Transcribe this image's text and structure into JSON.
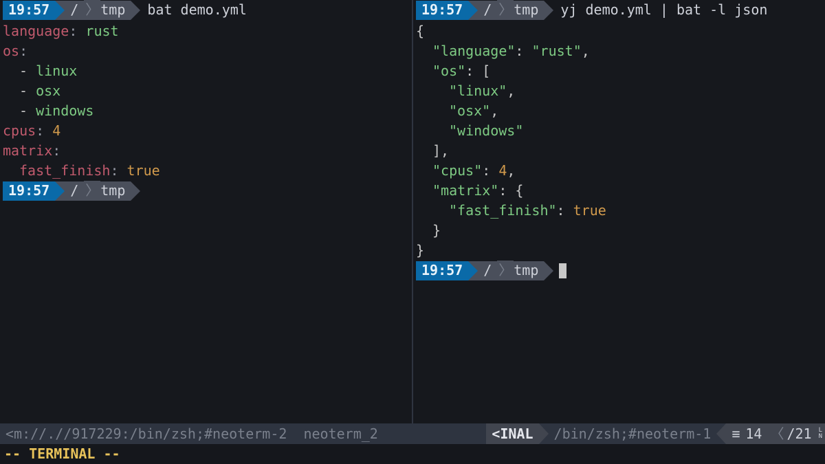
{
  "left": {
    "prompt1": {
      "time": "19:57",
      "root": "/",
      "dir": "tmp",
      "cmd": "bat demo.yml"
    },
    "yaml": {
      "language_key": "language",
      "language_val": "rust",
      "os_key": "os",
      "os_items": [
        "linux",
        "osx",
        "windows"
      ],
      "cpus_key": "cpus",
      "cpus_val": "4",
      "matrix_key": "matrix",
      "ff_key": "fast_finish",
      "ff_val": "true"
    },
    "prompt2": {
      "time": "19:57",
      "root": "/",
      "dir": "tmp"
    }
  },
  "right": {
    "prompt1": {
      "time": "19:57",
      "root": "/",
      "dir": "tmp",
      "cmd": "yj demo.yml | bat -l json"
    },
    "json": {
      "brace_open": "{",
      "language_key": "\"language\"",
      "language_val": "\"rust\"",
      "os_key": "\"os\"",
      "bracket_open": "[",
      "os_items": [
        "\"linux\"",
        "\"osx\"",
        "\"windows\""
      ],
      "bracket_close": "]",
      "cpus_key": "\"cpus\"",
      "cpus_val": "4",
      "matrix_key": "\"matrix\"",
      "brace_open2": "{",
      "ff_key": "\"fast_finish\"",
      "ff_val": "true",
      "brace_close2": "}",
      "brace_close": "}"
    },
    "prompt2": {
      "time": "19:57",
      "root": "/",
      "dir": "tmp"
    }
  },
  "statusbar": {
    "left_text": "<m://.//917229:/bin/zsh;#neoterm-2  neoterm_2",
    "right_mode": "<INAL",
    "right_path": "/bin/zsh;#neoterm-1",
    "hamburger": "≡",
    "cur": "14",
    "total": "/21",
    "ln_top": "L",
    "ln_bot": "N"
  },
  "modeline": "-- TERMINAL --"
}
